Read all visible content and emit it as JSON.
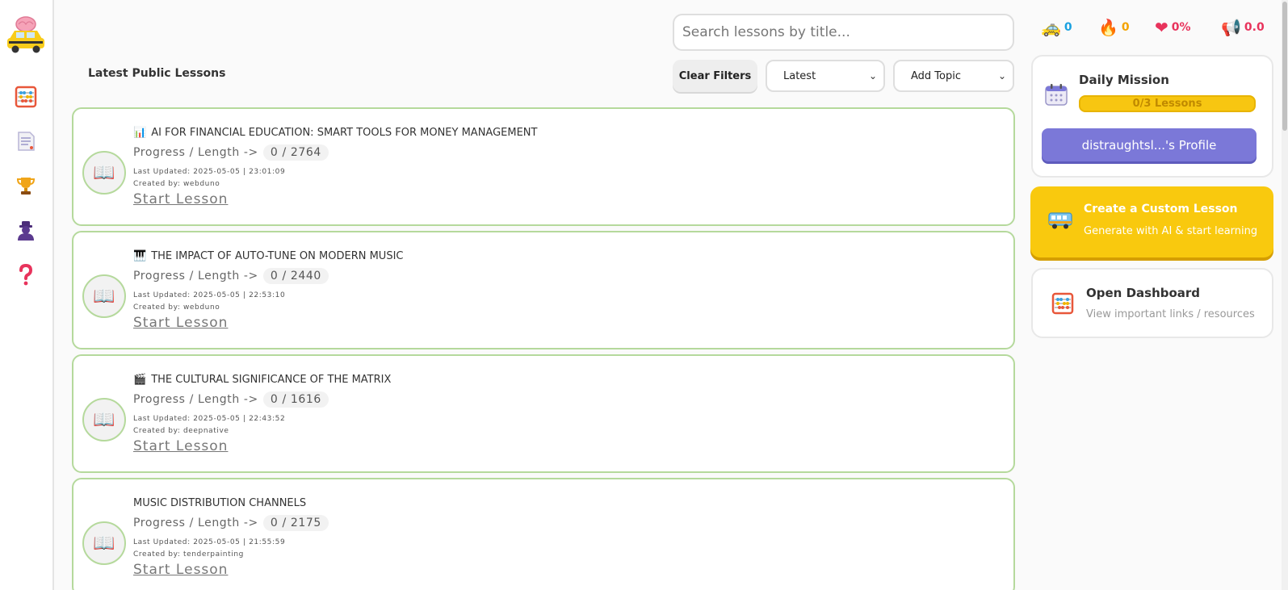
{
  "sidebar": {
    "items": [
      {
        "name": "abacus",
        "icon": "abacus-icon"
      },
      {
        "name": "notes",
        "icon": "notepad-icon"
      },
      {
        "name": "leaderboard",
        "icon": "trophy-icon"
      },
      {
        "name": "profile",
        "icon": "user-icon"
      },
      {
        "name": "help",
        "icon": "question-icon"
      }
    ]
  },
  "search": {
    "placeholder": "Search lessons by title...",
    "value": ""
  },
  "section_title": "Latest Public Lessons",
  "filters": {
    "clear_label": "Clear Filters",
    "sort_selected": "Latest",
    "topic_selected": "Add Topic"
  },
  "lessons": [
    {
      "emoji": "📊",
      "title": "AI FOR FINANCIAL EDUCATION: SMART TOOLS FOR MONEY MANAGEMENT",
      "progress_label": "Progress / Length ->",
      "progress": "0 / 2764",
      "updated": "Last Updated: 2025-05-05 | 23:01:09",
      "created": "Created by: webduno",
      "start_label": "Start Lesson",
      "badge": "📖"
    },
    {
      "emoji": "🎹",
      "title": "THE IMPACT OF AUTO-TUNE ON MODERN MUSIC",
      "progress_label": "Progress / Length ->",
      "progress": "0 / 2440",
      "updated": "Last Updated: 2025-05-05 | 22:53:10",
      "created": "Created by: webduno",
      "start_label": "Start Lesson",
      "badge": "📖"
    },
    {
      "emoji": "🎬",
      "title": "THE CULTURAL SIGNIFICANCE OF THE MATRIX",
      "progress_label": "Progress / Length ->",
      "progress": "0 / 1616",
      "updated": "Last Updated: 2025-05-05 | 22:43:52",
      "created": "Created by: deepnative",
      "start_label": "Start Lesson",
      "badge": "📖"
    },
    {
      "emoji": "",
      "title": "MUSIC DISTRIBUTION CHANNELS",
      "progress_label": "Progress / Length ->",
      "progress": "0 / 2175",
      "updated": "Last Updated: 2025-05-05 | 21:55:59",
      "created": "Created by: tenderpainting",
      "start_label": "Start Lesson",
      "badge": "📖"
    }
  ],
  "stats": [
    {
      "icon": "taxi-icon",
      "glyph": "🚕",
      "value": "0",
      "color": "#1aa1e0"
    },
    {
      "icon": "flame-icon",
      "glyph": "🔥",
      "value": "0",
      "color": "#f4a300"
    },
    {
      "icon": "heart-icon",
      "glyph": "❤",
      "value": "0%",
      "color": "#e8335c"
    },
    {
      "icon": "megaphone-icon",
      "glyph": "📢",
      "value": "0.0",
      "color": "#e8335c"
    }
  ],
  "daily_mission": {
    "title": "Daily Mission",
    "progress_text": "0/3 Lessons",
    "profile_button": "distraughtsl...'s Profile"
  },
  "create_lesson": {
    "title": "Create a Custom Lesson",
    "subtitle": "Generate with AI & start learning",
    "icon": "bus-icon"
  },
  "dashboard": {
    "title": "Open Dashboard",
    "subtitle": "View important links / resources",
    "icon": "abacus-icon"
  },
  "colors": {
    "card_border": "#b5d99c",
    "accent_yellow": "#f9c90e",
    "profile_purple": "#7b78d8"
  }
}
